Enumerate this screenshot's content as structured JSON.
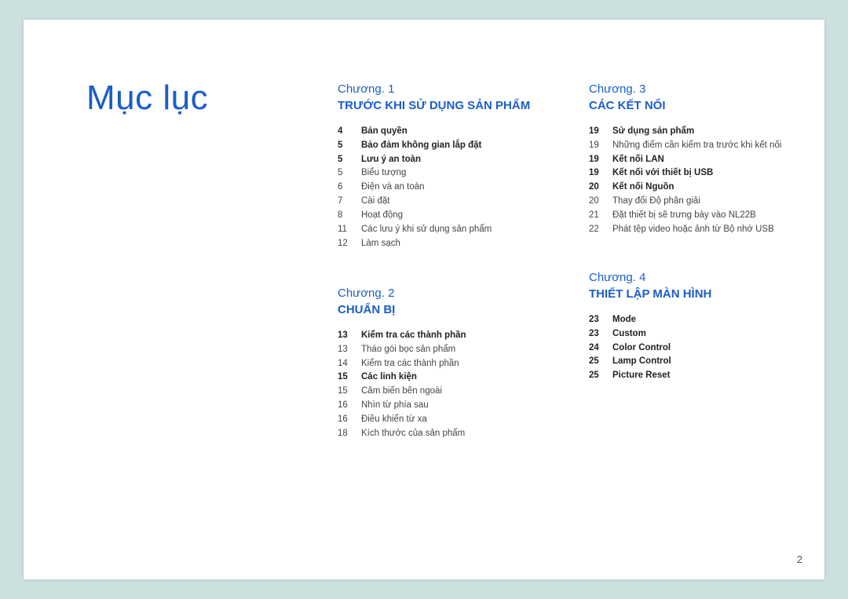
{
  "title": "Mục lục",
  "page_number": "2",
  "chapters": [
    {
      "num": "Chương. 1",
      "title": "TRƯỚC KHI SỬ DỤNG SẢN PHẨM",
      "entries": [
        {
          "page": "4",
          "label": "Bản quyền",
          "bold": true
        },
        {
          "page": "5",
          "label": "Bảo đảm không gian lắp đặt",
          "bold": true
        },
        {
          "page": "5",
          "label": "Lưu ý an toàn",
          "bold": true
        },
        {
          "page": "5",
          "label": "Biểu tượng",
          "bold": false
        },
        {
          "page": "6",
          "label": "Điện và an toàn",
          "bold": false
        },
        {
          "page": "7",
          "label": "Cài đặt",
          "bold": false
        },
        {
          "page": "8",
          "label": "Hoạt động",
          "bold": false
        },
        {
          "page": "11",
          "label": "Các lưu ý khi sử dụng sản phẩm",
          "bold": false
        },
        {
          "page": "12",
          "label": "Làm sạch",
          "bold": false
        }
      ]
    },
    {
      "num": "Chương. 2",
      "title": "CHUẨN BỊ",
      "entries": [
        {
          "page": "13",
          "label": "Kiểm tra các thành phần",
          "bold": true
        },
        {
          "page": "13",
          "label": "Tháo gói bọc sản phẩm",
          "bold": false
        },
        {
          "page": "14",
          "label": "Kiểm tra các thành phần",
          "bold": false
        },
        {
          "page": "15",
          "label": "Các linh kiện",
          "bold": true
        },
        {
          "page": "15",
          "label": "Cảm biến bên ngoài",
          "bold": false
        },
        {
          "page": "16",
          "label": "Nhìn từ phía sau",
          "bold": false
        },
        {
          "page": "16",
          "label": "Điều khiển từ xa",
          "bold": false
        },
        {
          "page": "18",
          "label": "Kích thước của sản phẩm",
          "bold": false
        }
      ]
    },
    {
      "num": "Chương. 3",
      "title": "CÁC KẾT NỐI",
      "entries": [
        {
          "page": "19",
          "label": "Sử dụng sản phẩm",
          "bold": true
        },
        {
          "page": "19",
          "label": "Những điểm cần kiểm tra trước khi kết nối",
          "bold": false
        },
        {
          "page": "19",
          "label": "Kết nối LAN",
          "bold": true
        },
        {
          "page": "19",
          "label": "Kết nối với thiết bị USB",
          "bold": true
        },
        {
          "page": "20",
          "label": "Kết nối Nguồn",
          "bold": true
        },
        {
          "page": "20",
          "label": "Thay đổi Độ phân giải",
          "bold": false
        },
        {
          "page": "21",
          "label": "Đặt thiết bị sẽ trưng bày vào NL22B",
          "bold": false
        },
        {
          "page": "22",
          "label": "Phát tệp video hoặc ảnh từ Bộ nhớ USB",
          "bold": false
        }
      ]
    },
    {
      "num": "Chương. 4",
      "title": "THIẾT LẬP MÀN HÌNH",
      "entries": [
        {
          "page": "23",
          "label": "Mode",
          "bold": true
        },
        {
          "page": "23",
          "label": "Custom",
          "bold": true
        },
        {
          "page": "24",
          "label": "Color Control",
          "bold": true
        },
        {
          "page": "25",
          "label": "Lamp Control",
          "bold": true
        },
        {
          "page": "25",
          "label": "Picture Reset",
          "bold": true
        }
      ]
    }
  ]
}
